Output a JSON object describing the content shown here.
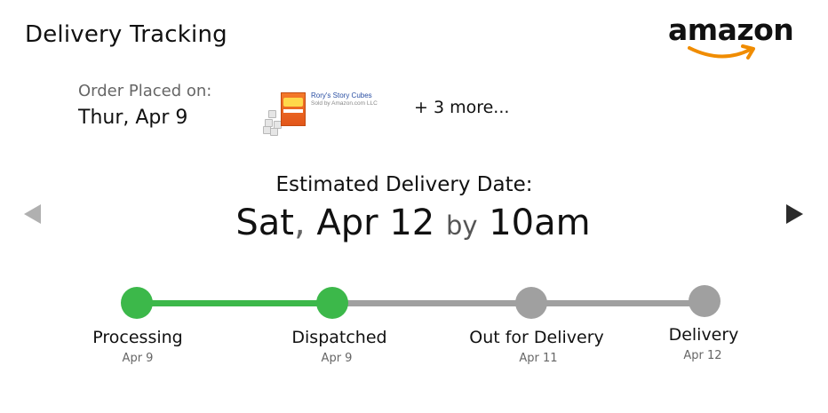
{
  "header": {
    "title": "Delivery Tracking",
    "logo_text": "amazon"
  },
  "order": {
    "placed_label": "Order Placed on:",
    "placed_date": "Thur, Apr 9",
    "product": {
      "name": "Rory's Story Cubes",
      "seller": "Sold by Amazon.com LLC"
    },
    "more_link": "+ 3 more..."
  },
  "estimate": {
    "label": "Estimated Delivery Date:",
    "day": "Sat",
    "comma": ",",
    "date": "Apr 12",
    "by": "by",
    "time": "10am"
  },
  "steps": [
    {
      "label": "Processing",
      "date": "Apr 9",
      "status": "done"
    },
    {
      "label": "Dispatched",
      "date": "Apr 9",
      "status": "done"
    },
    {
      "label": "Out for Delivery",
      "date": "Apr 11",
      "status": "pending"
    },
    {
      "label": "Delivery",
      "date": "Apr 12",
      "status": "pending"
    }
  ],
  "colors": {
    "done": "#3cb84a",
    "pending": "#a0a0a0",
    "logo_smile": "#f08c00"
  },
  "icons": {
    "prev": "triangle-left",
    "next": "triangle-right"
  }
}
